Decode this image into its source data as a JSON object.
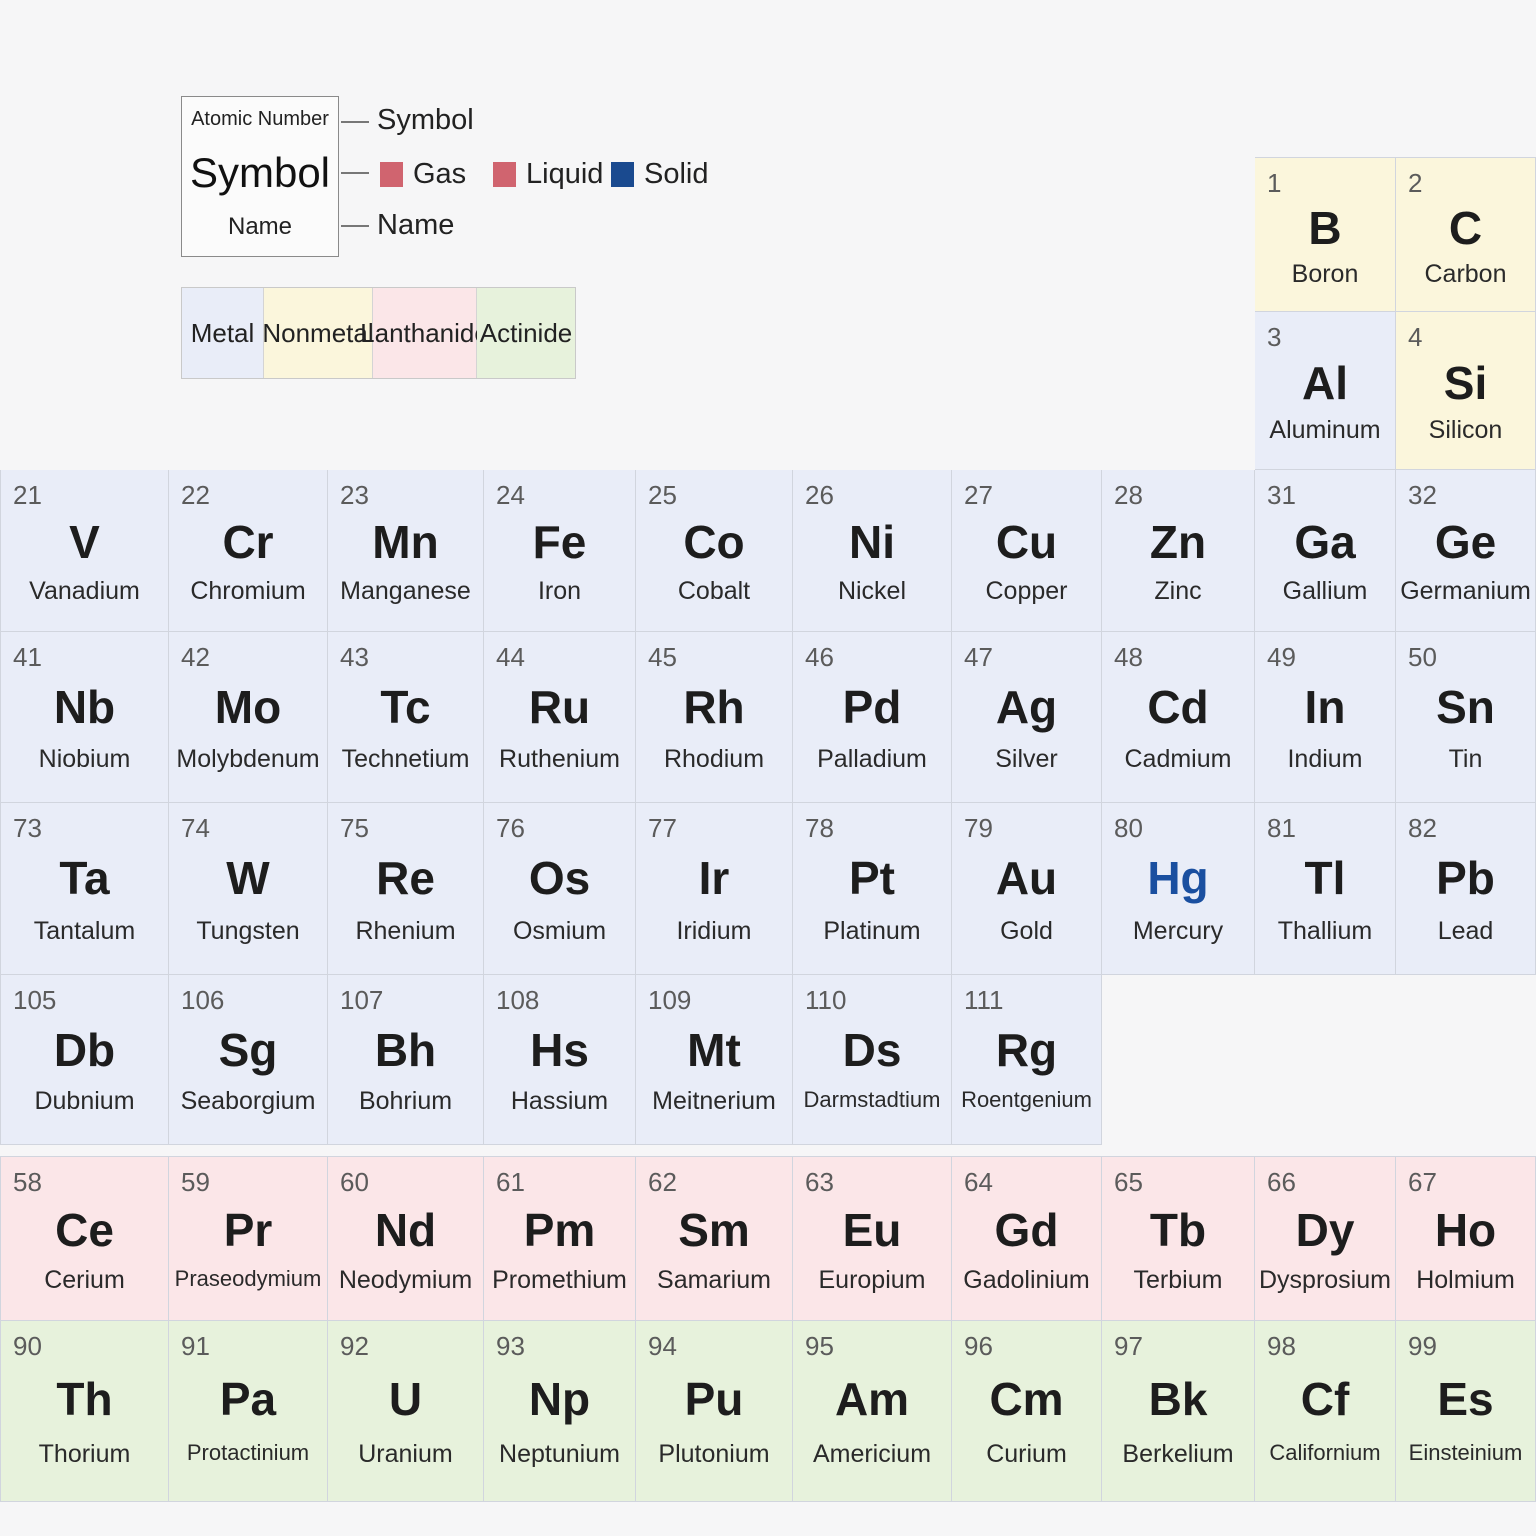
{
  "legend": {
    "key": {
      "number_label": "Atomic Number",
      "symbol_label": "Symbol",
      "name_label": "Name"
    },
    "pointer_labels": {
      "symbol": "Symbol",
      "name": "Name"
    },
    "states": [
      {
        "label": "Gas",
        "color": "#d0646f"
      },
      {
        "label": "Liquid",
        "color": "#d0646f"
      },
      {
        "label": "Solid",
        "color": "#1a4a8f"
      }
    ]
  },
  "categories": [
    {
      "label": "Metal",
      "color": "#e9edf8"
    },
    {
      "label": "Nonmetal",
      "color": "#fbf6dc"
    },
    {
      "label": "Lanthanide",
      "color": "#fbe6e8"
    },
    {
      "label": "Actinide",
      "color": "#e7f2dc"
    }
  ],
  "colors": {
    "metal": "#e9edf8",
    "nonmetal": "#fbf6dc",
    "lanthanide": "#fbe6e8",
    "actinide": "#e7f2dc",
    "liquid_symbol": "#1a4fa0"
  },
  "rows": [
    {
      "elements": [
        {
          "n": "1",
          "s": "B",
          "name": "Boron",
          "cat": "nonmetal"
        },
        {
          "n": "2",
          "s": "C",
          "name": "Carbon",
          "cat": "nonmetal"
        }
      ]
    },
    {
      "elements": [
        {
          "n": "3",
          "s": "Al",
          "name": "Aluminum",
          "cat": "metal"
        },
        {
          "n": "4",
          "s": "Si",
          "name": "Silicon",
          "cat": "nonmetal"
        }
      ]
    },
    {
      "elements": [
        {
          "n": "21",
          "s": "V",
          "name": "Vanadium",
          "cat": "metal"
        },
        {
          "n": "22",
          "s": "Cr",
          "name": "Chromium",
          "cat": "metal"
        },
        {
          "n": "23",
          "s": "Mn",
          "name": "Manganese",
          "cat": "metal"
        },
        {
          "n": "24",
          "s": "Fe",
          "name": "Iron",
          "cat": "metal"
        },
        {
          "n": "25",
          "s": "Co",
          "name": "Cobalt",
          "cat": "metal"
        },
        {
          "n": "26",
          "s": "Ni",
          "name": "Nickel",
          "cat": "metal"
        },
        {
          "n": "27",
          "s": "Cu",
          "name": "Copper",
          "cat": "metal"
        },
        {
          "n": "28",
          "s": "Zn",
          "name": "Zinc",
          "cat": "metal"
        },
        {
          "n": "31",
          "s": "Ga",
          "name": "Gallium",
          "cat": "metal"
        },
        {
          "n": "32",
          "s": "Ge",
          "name": "Germanium",
          "cat": "metal"
        }
      ]
    },
    {
      "elements": [
        {
          "n": "41",
          "s": "Nb",
          "name": "Niobium",
          "cat": "metal"
        },
        {
          "n": "42",
          "s": "Mo",
          "name": "Molybdenum",
          "cat": "metal"
        },
        {
          "n": "43",
          "s": "Tc",
          "name": "Technetium",
          "cat": "metal"
        },
        {
          "n": "44",
          "s": "Ru",
          "name": "Ruthenium",
          "cat": "metal"
        },
        {
          "n": "45",
          "s": "Rh",
          "name": "Rhodium",
          "cat": "metal"
        },
        {
          "n": "46",
          "s": "Pd",
          "name": "Palladium",
          "cat": "metal"
        },
        {
          "n": "47",
          "s": "Ag",
          "name": "Silver",
          "cat": "metal"
        },
        {
          "n": "48",
          "s": "Cd",
          "name": "Cadmium",
          "cat": "metal"
        },
        {
          "n": "49",
          "s": "In",
          "name": "Indium",
          "cat": "metal"
        },
        {
          "n": "50",
          "s": "Sn",
          "name": "Tin",
          "cat": "metal"
        }
      ]
    },
    {
      "elements": [
        {
          "n": "73",
          "s": "Ta",
          "name": "Tantalum",
          "cat": "metal"
        },
        {
          "n": "74",
          "s": "W",
          "name": "Tungsten",
          "cat": "metal"
        },
        {
          "n": "75",
          "s": "Re",
          "name": "Rhenium",
          "cat": "metal"
        },
        {
          "n": "76",
          "s": "Os",
          "name": "Osmium",
          "cat": "metal"
        },
        {
          "n": "77",
          "s": "Ir",
          "name": "Iridium",
          "cat": "metal"
        },
        {
          "n": "78",
          "s": "Pt",
          "name": "Platinum",
          "cat": "metal"
        },
        {
          "n": "79",
          "s": "Au",
          "name": "Gold",
          "cat": "metal"
        },
        {
          "n": "80",
          "s": "Hg",
          "name": "Mercury",
          "cat": "metal",
          "liquid": true
        },
        {
          "n": "81",
          "s": "Tl",
          "name": "Thallium",
          "cat": "metal"
        },
        {
          "n": "82",
          "s": "Pb",
          "name": "Lead",
          "cat": "metal"
        }
      ]
    },
    {
      "elements": [
        {
          "n": "105",
          "s": "Db",
          "name": "Dubnium",
          "cat": "metal"
        },
        {
          "n": "106",
          "s": "Sg",
          "name": "Seaborgium",
          "cat": "metal"
        },
        {
          "n": "107",
          "s": "Bh",
          "name": "Bohrium",
          "cat": "metal"
        },
        {
          "n": "108",
          "s": "Hs",
          "name": "Hassium",
          "cat": "metal"
        },
        {
          "n": "109",
          "s": "Mt",
          "name": "Meitnerium",
          "cat": "metal"
        },
        {
          "n": "110",
          "s": "Ds",
          "name": "Darmstadtium",
          "cat": "metal"
        },
        {
          "n": "111",
          "s": "Rg",
          "name": "Roentgenium",
          "cat": "metal"
        }
      ]
    },
    {
      "elements": [
        {
          "n": "58",
          "s": "Ce",
          "name": "Cerium",
          "cat": "lanthanide"
        },
        {
          "n": "59",
          "s": "Pr",
          "name": "Praseodymium",
          "cat": "lanthanide"
        },
        {
          "n": "60",
          "s": "Nd",
          "name": "Neodymium",
          "cat": "lanthanide"
        },
        {
          "n": "61",
          "s": "Pm",
          "name": "Promethium",
          "cat": "lanthanide"
        },
        {
          "n": "62",
          "s": "Sm",
          "name": "Samarium",
          "cat": "lanthanide"
        },
        {
          "n": "63",
          "s": "Eu",
          "name": "Europium",
          "cat": "lanthanide"
        },
        {
          "n": "64",
          "s": "Gd",
          "name": "Gadolinium",
          "cat": "lanthanide"
        },
        {
          "n": "65",
          "s": "Tb",
          "name": "Terbium",
          "cat": "lanthanide"
        },
        {
          "n": "66",
          "s": "Dy",
          "name": "Dysprosium",
          "cat": "lanthanide"
        },
        {
          "n": "67",
          "s": "Ho",
          "name": "Holmium",
          "cat": "lanthanide"
        }
      ]
    },
    {
      "elements": [
        {
          "n": "90",
          "s": "Th",
          "name": "Thorium",
          "cat": "actinide"
        },
        {
          "n": "91",
          "s": "Pa",
          "name": "Protactinium",
          "cat": "actinide"
        },
        {
          "n": "92",
          "s": "U",
          "name": "Uranium",
          "cat": "actinide"
        },
        {
          "n": "93",
          "s": "Np",
          "name": "Neptunium",
          "cat": "actinide"
        },
        {
          "n": "94",
          "s": "Pu",
          "name": "Plutonium",
          "cat": "actinide"
        },
        {
          "n": "95",
          "s": "Am",
          "name": "Americium",
          "cat": "actinide"
        },
        {
          "n": "96",
          "s": "Cm",
          "name": "Curium",
          "cat": "actinide"
        },
        {
          "n": "97",
          "s": "Bk",
          "name": "Berkelium",
          "cat": "actinide"
        },
        {
          "n": "98",
          "s": "Cf",
          "name": "Californium",
          "cat": "actinide"
        },
        {
          "n": "99",
          "s": "Es",
          "name": "Einsteinium",
          "cat": "actinide"
        }
      ]
    }
  ]
}
